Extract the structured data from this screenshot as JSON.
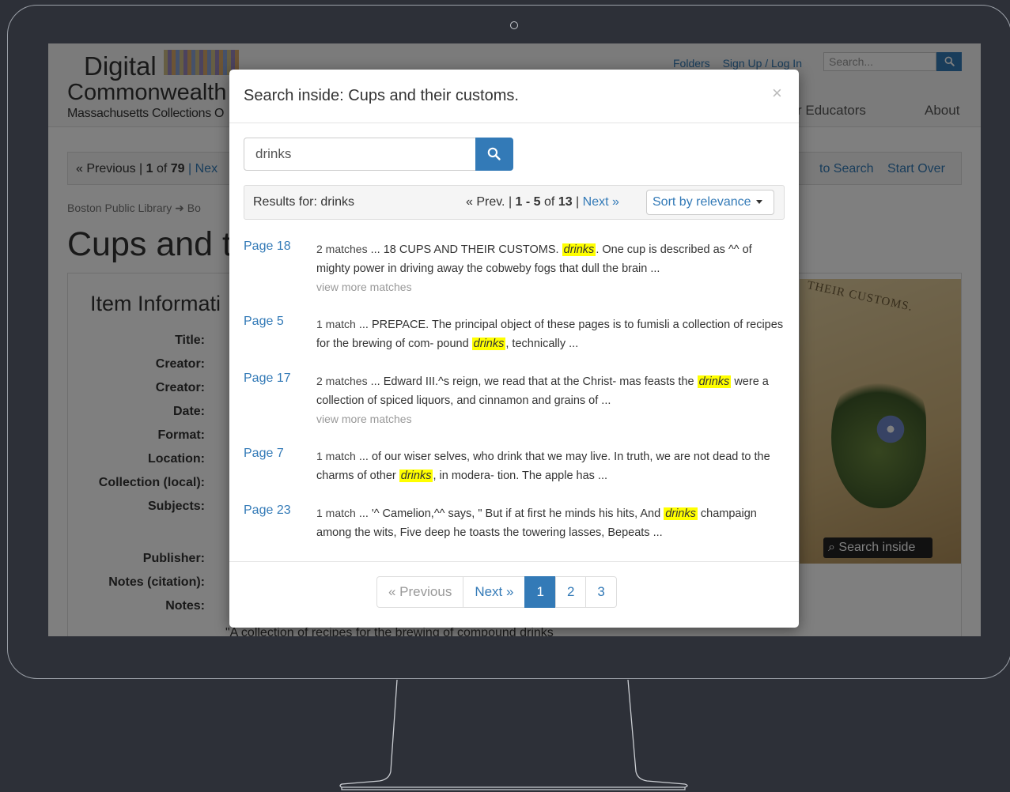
{
  "site": {
    "logo_title": "Digital",
    "logo_subtitle": "Commonwealth",
    "logo_tagline": "Massachusetts Collections O",
    "header_links": [
      "Folders",
      "Sign Up / Log In"
    ],
    "search_placeholder": "Search...",
    "nav_educators": "r Educators",
    "nav_about": "About",
    "crumbbar_left_prev": "« Previous | ",
    "crumbbar_left_pos": "1",
    "crumbbar_left_of": " of ",
    "crumbbar_left_total": "79",
    "crumbbar_left_next": " | Nex",
    "crumbbar_back": "to Search",
    "crumbbar_start_over": "Start Over",
    "breadcrumb": "Boston Public Library ➜ Bo",
    "page_title": "Cups and t",
    "item_heading": "Item Informati",
    "fields": [
      "Title:",
      "Creator:",
      "Creator:",
      "Date:",
      "Format:",
      "Location:",
      "Collection (local):",
      "Subjects:",
      "",
      "",
      "Publisher:",
      "Notes (citation):",
      "Notes:"
    ],
    "cover_text": "THEIR CUSTOMS.",
    "search_inside_bg": "Search inside",
    "notes_line": "\"A collection of recipes for the brewing of compound drinks"
  },
  "modal": {
    "title": "Search inside: Cups and their customs.",
    "close": "×",
    "search_value": "drinks",
    "results_label": "Results for: drinks",
    "pager_prev": "« Prev.",
    "pager_sep": " | ",
    "pager_range_start": "1",
    "pager_dash": " - ",
    "pager_range_end": "5",
    "pager_of": " of ",
    "pager_total": "13",
    "pager_next": "Next »",
    "sort_label": "Sort by relevance",
    "results": [
      {
        "page": "Page 18",
        "count": "2 matches",
        "before": " ... 18 CUPS AND THEIR CUSTOMS. ",
        "term": "drinks",
        "after": ". One cup is described as ^^ of mighty power in driving away the cobweby fogs that dull the brain ...",
        "more": "view more matches"
      },
      {
        "page": "Page 5",
        "count": "1 match",
        "before": " ... PREPACE. The principal object of these pages is to fumisli a collection of recipes for the brewing of com- pound ",
        "term": "drinks",
        "after": ", technically ...",
        "more": ""
      },
      {
        "page": "Page 17",
        "count": "2 matches",
        "before": " ... Edward III.^s reign, we read that at the Christ- mas feasts the ",
        "term": "drinks",
        "after": " were a collection of spiced liquors, and cinnamon and grains of ...",
        "more": "view more matches"
      },
      {
        "page": "Page 7",
        "count": "1 match",
        "before": " ... of our wiser selves, who drink that we may live. In truth, we are not dead to the charms of other ",
        "term": "drinks",
        "after": ", in modera- tion. The apple has ...",
        "more": ""
      },
      {
        "page": "Page 23",
        "count": "1 match",
        "before": " ... '^ Camelion,^^ says, \" But if at first he minds his hits, And ",
        "term": "drinks",
        "after": " champaign among the wits, Five deep he toasts the towering lasses, Bepeats ...",
        "more": ""
      }
    ],
    "pagination": {
      "previous": "« Previous",
      "next": "Next »",
      "pages": [
        "1",
        "2",
        "3"
      ],
      "active": "1"
    }
  },
  "colors": {
    "link": "#337ab7",
    "highlight": "#ffff00",
    "overlay": "rgba(0,0,0,0.5)"
  }
}
